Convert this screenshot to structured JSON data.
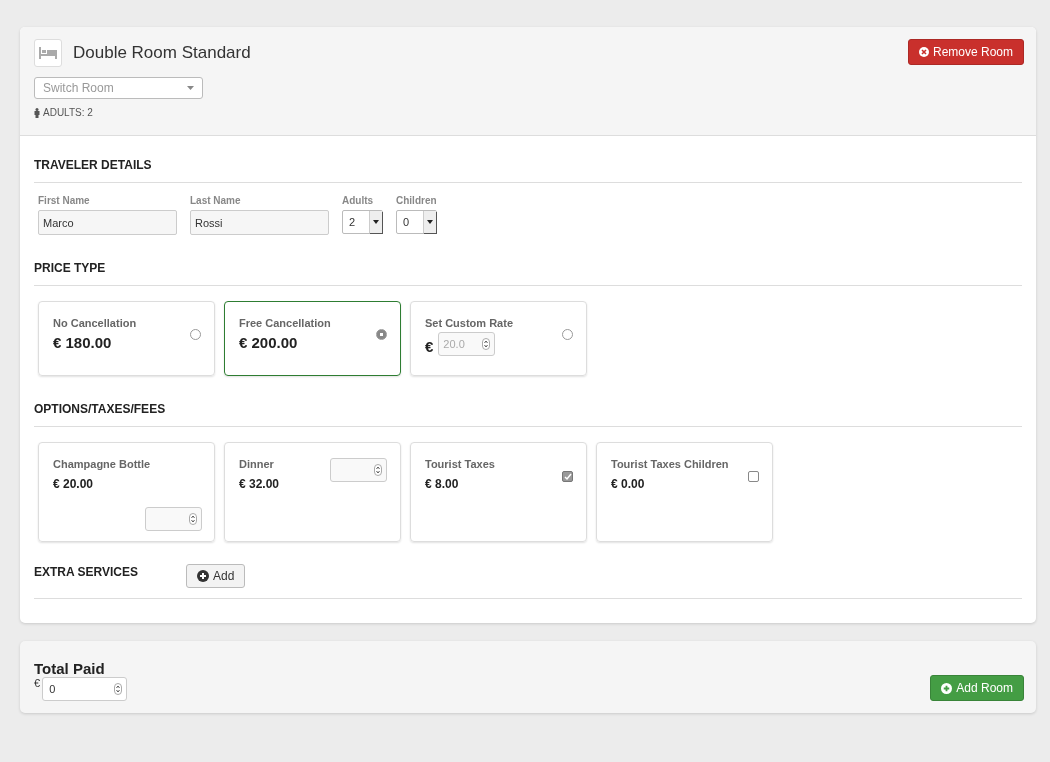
{
  "room": {
    "title": "Double Room Standard",
    "remove_button": "Remove Room",
    "switch": {
      "placeholder": "Switch Room"
    },
    "occupancy": "ADULTS: 2"
  },
  "traveler": {
    "heading": "TRAVELER DETAILS",
    "fields": [
      {
        "label": "First Name",
        "kind": "text",
        "value": "Marco"
      },
      {
        "label": "Last Name",
        "kind": "text",
        "value": "Rossi"
      },
      {
        "label": "Adults",
        "kind": "select",
        "value": "2"
      },
      {
        "label": "Children",
        "kind": "select",
        "value": "0"
      }
    ]
  },
  "price_type": {
    "heading": "PRICE TYPE",
    "options": [
      {
        "name": "No Cancellation",
        "kind": "fixed",
        "price": "€ 180.00",
        "selected": false
      },
      {
        "name": "Free Cancellation",
        "kind": "fixed",
        "price": "€ 200.00",
        "selected": true
      },
      {
        "name": "Set Custom Rate",
        "kind": "custom",
        "currency": "€",
        "placeholder": "20.0",
        "selected": false
      }
    ]
  },
  "options": {
    "heading": "OPTIONS/TAXES/FEES",
    "items": [
      {
        "name": "Champagne Bottle",
        "price": "€ 20.00",
        "kind": "counter"
      },
      {
        "name": "Dinner",
        "price": "€ 32.00",
        "kind": "stepper"
      },
      {
        "name": "Tourist Taxes",
        "price": "€ 8.00",
        "kind": "checkbox",
        "checked": true
      },
      {
        "name": "Tourist Taxes Children",
        "price": "€ 0.00",
        "kind": "checkbox",
        "checked": false
      }
    ]
  },
  "extra_services": {
    "heading": "EXTRA SERVICES",
    "add_button": "Add"
  },
  "total": {
    "title": "Total Paid",
    "currency": "€",
    "value": "0",
    "add_room_button": "Add Room"
  }
}
